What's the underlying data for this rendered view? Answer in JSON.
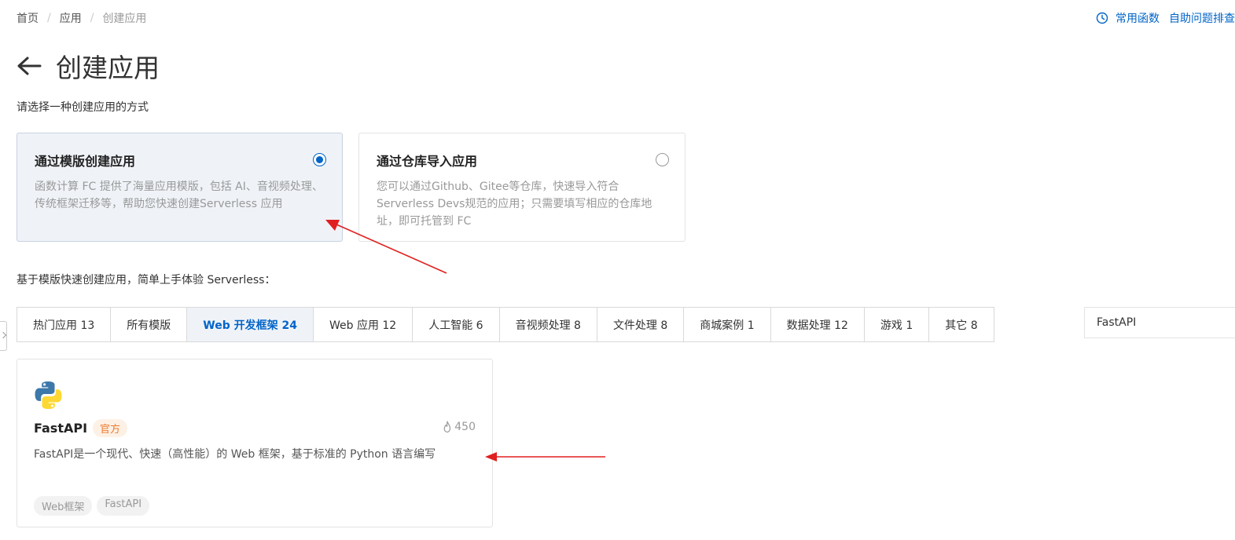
{
  "breadcrumb": {
    "home": "首页",
    "apps": "应用",
    "current": "创建应用"
  },
  "top_links": {
    "functions": "常用函数",
    "troubleshoot": "自助问题排查"
  },
  "page": {
    "title": "创建应用",
    "prompt": "请选择一种创建应用的方式"
  },
  "methods": [
    {
      "title": "通过模版创建应用",
      "desc": "函数计算 FC 提供了海量应用模版，包括 AI、音视频处理、传统框架迁移等，帮助您快速创建Serverless 应用",
      "selected": true
    },
    {
      "title": "通过仓库导入应用",
      "desc": "您可以通过Github、Gitee等仓库，快速导入符合 Serverless Devs规范的应用；只需要填写相应的仓库地址，即可托管到 FC",
      "selected": false
    }
  ],
  "templates_prompt": "基于模版快速创建应用，简单上手体验 Serverless：",
  "tabs": [
    {
      "label": "热门应用 13",
      "active": false
    },
    {
      "label": "所有模版",
      "active": false
    },
    {
      "label": "Web 开发框架 24",
      "active": true
    },
    {
      "label": "Web 应用 12",
      "active": false
    },
    {
      "label": "人工智能 6",
      "active": false
    },
    {
      "label": "音视频处理 8",
      "active": false
    },
    {
      "label": "文件处理 8",
      "active": false
    },
    {
      "label": "商城案例 1",
      "active": false
    },
    {
      "label": "数据处理 12",
      "active": false
    },
    {
      "label": "游戏 1",
      "active": false
    },
    {
      "label": "其它 8",
      "active": false
    }
  ],
  "search": {
    "value": "FastAPI"
  },
  "template": {
    "name": "FastAPI",
    "badge": "官方",
    "hot_count": "450",
    "desc": "FastAPI是一个现代、快速（高性能）的 Web 框架，基于标准的 Python 语言编写",
    "tags": [
      "Web框架",
      "FastAPI"
    ]
  },
  "colors": {
    "primary": "#0064c8",
    "annotation": "#e02020",
    "badge": "#ed7b2f"
  },
  "icons": {
    "back": "arrow-left-icon",
    "clock": "clock-icon",
    "hot": "flame-icon",
    "logo": "python-logo-icon"
  }
}
